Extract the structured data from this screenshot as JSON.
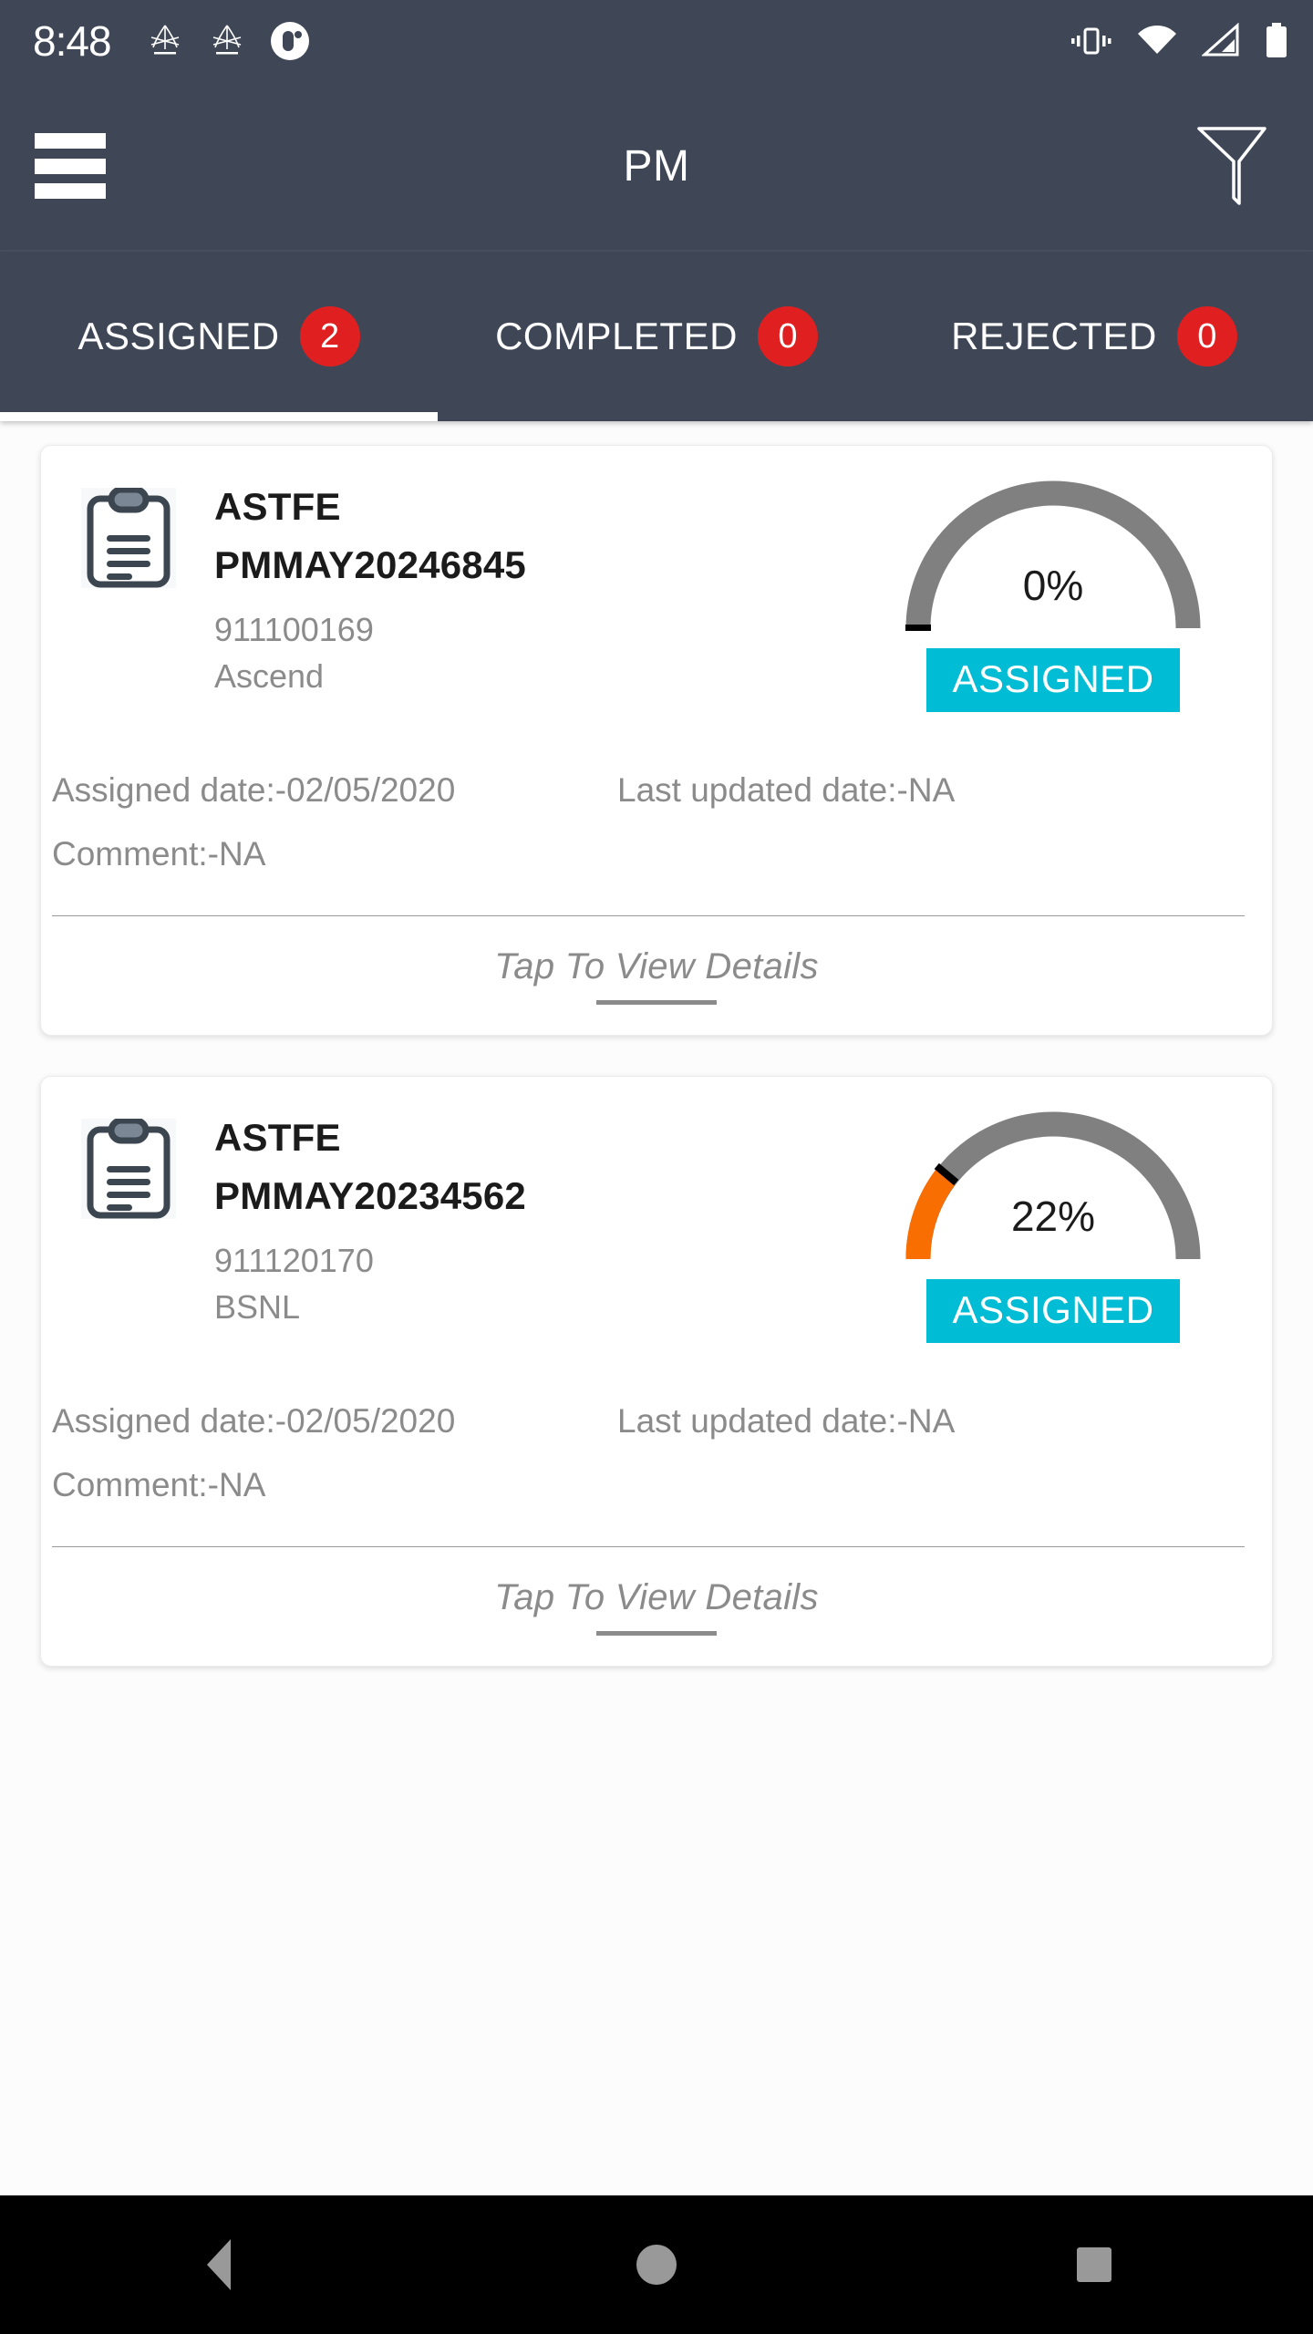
{
  "status_bar": {
    "time": "8:48",
    "left_icons": [
      "app-notification-icon",
      "app-notification-icon",
      "app-badge-icon"
    ],
    "right_icons": [
      "vibrate-icon",
      "wifi-icon",
      "cellular-signal-icon",
      "battery-icon"
    ]
  },
  "app_bar": {
    "menu_icon": "hamburger-menu-icon",
    "title": "PM",
    "filter_icon": "filter-funnel-icon"
  },
  "tabs": [
    {
      "label": "ASSIGNED",
      "badge": "2",
      "active": true
    },
    {
      "label": "COMPLETED",
      "badge": "0",
      "active": false
    },
    {
      "label": "REJECTED",
      "badge": "0",
      "active": false
    }
  ],
  "colors": {
    "appbar_bg": "#3f4757",
    "badge_red": "#e02020",
    "status_cyan": "#00bcd4",
    "gauge_track": "#808080",
    "gauge_fill": "#f96e00",
    "muted_text": "#8b8b8b"
  },
  "labels": {
    "assigned_date_prefix": "Assigned date:-",
    "last_updated_prefix": "Last updated date:-",
    "comment_prefix": "Comment:-",
    "tap_to_view": "Tap To View Details"
  },
  "cards": [
    {
      "icon": "clipboard-icon",
      "type": "ASTFE",
      "work_order_id": "PMMAY20246845",
      "site_id": "911100169",
      "operator": "Ascend",
      "progress_label": "0%",
      "progress_value": 0,
      "status": "ASSIGNED",
      "assigned_date": "Assigned date:-02/05/2020",
      "last_updated": "Last updated date:-NA",
      "comment": "Comment:-NA",
      "footer": "Tap To View Details"
    },
    {
      "icon": "clipboard-icon",
      "type": "ASTFE",
      "work_order_id": "PMMAY20234562",
      "site_id": "911120170",
      "operator": "BSNL",
      "progress_label": "22%",
      "progress_value": 22,
      "status": "ASSIGNED",
      "assigned_date": "Assigned date:-02/05/2020",
      "last_updated": "Last updated date:-NA",
      "comment": "Comment:-NA",
      "footer": "Tap To View Details"
    }
  ],
  "nav_bar": {
    "back": "back-nav-icon",
    "home": "home-nav-icon",
    "recents": "recents-nav-icon"
  }
}
